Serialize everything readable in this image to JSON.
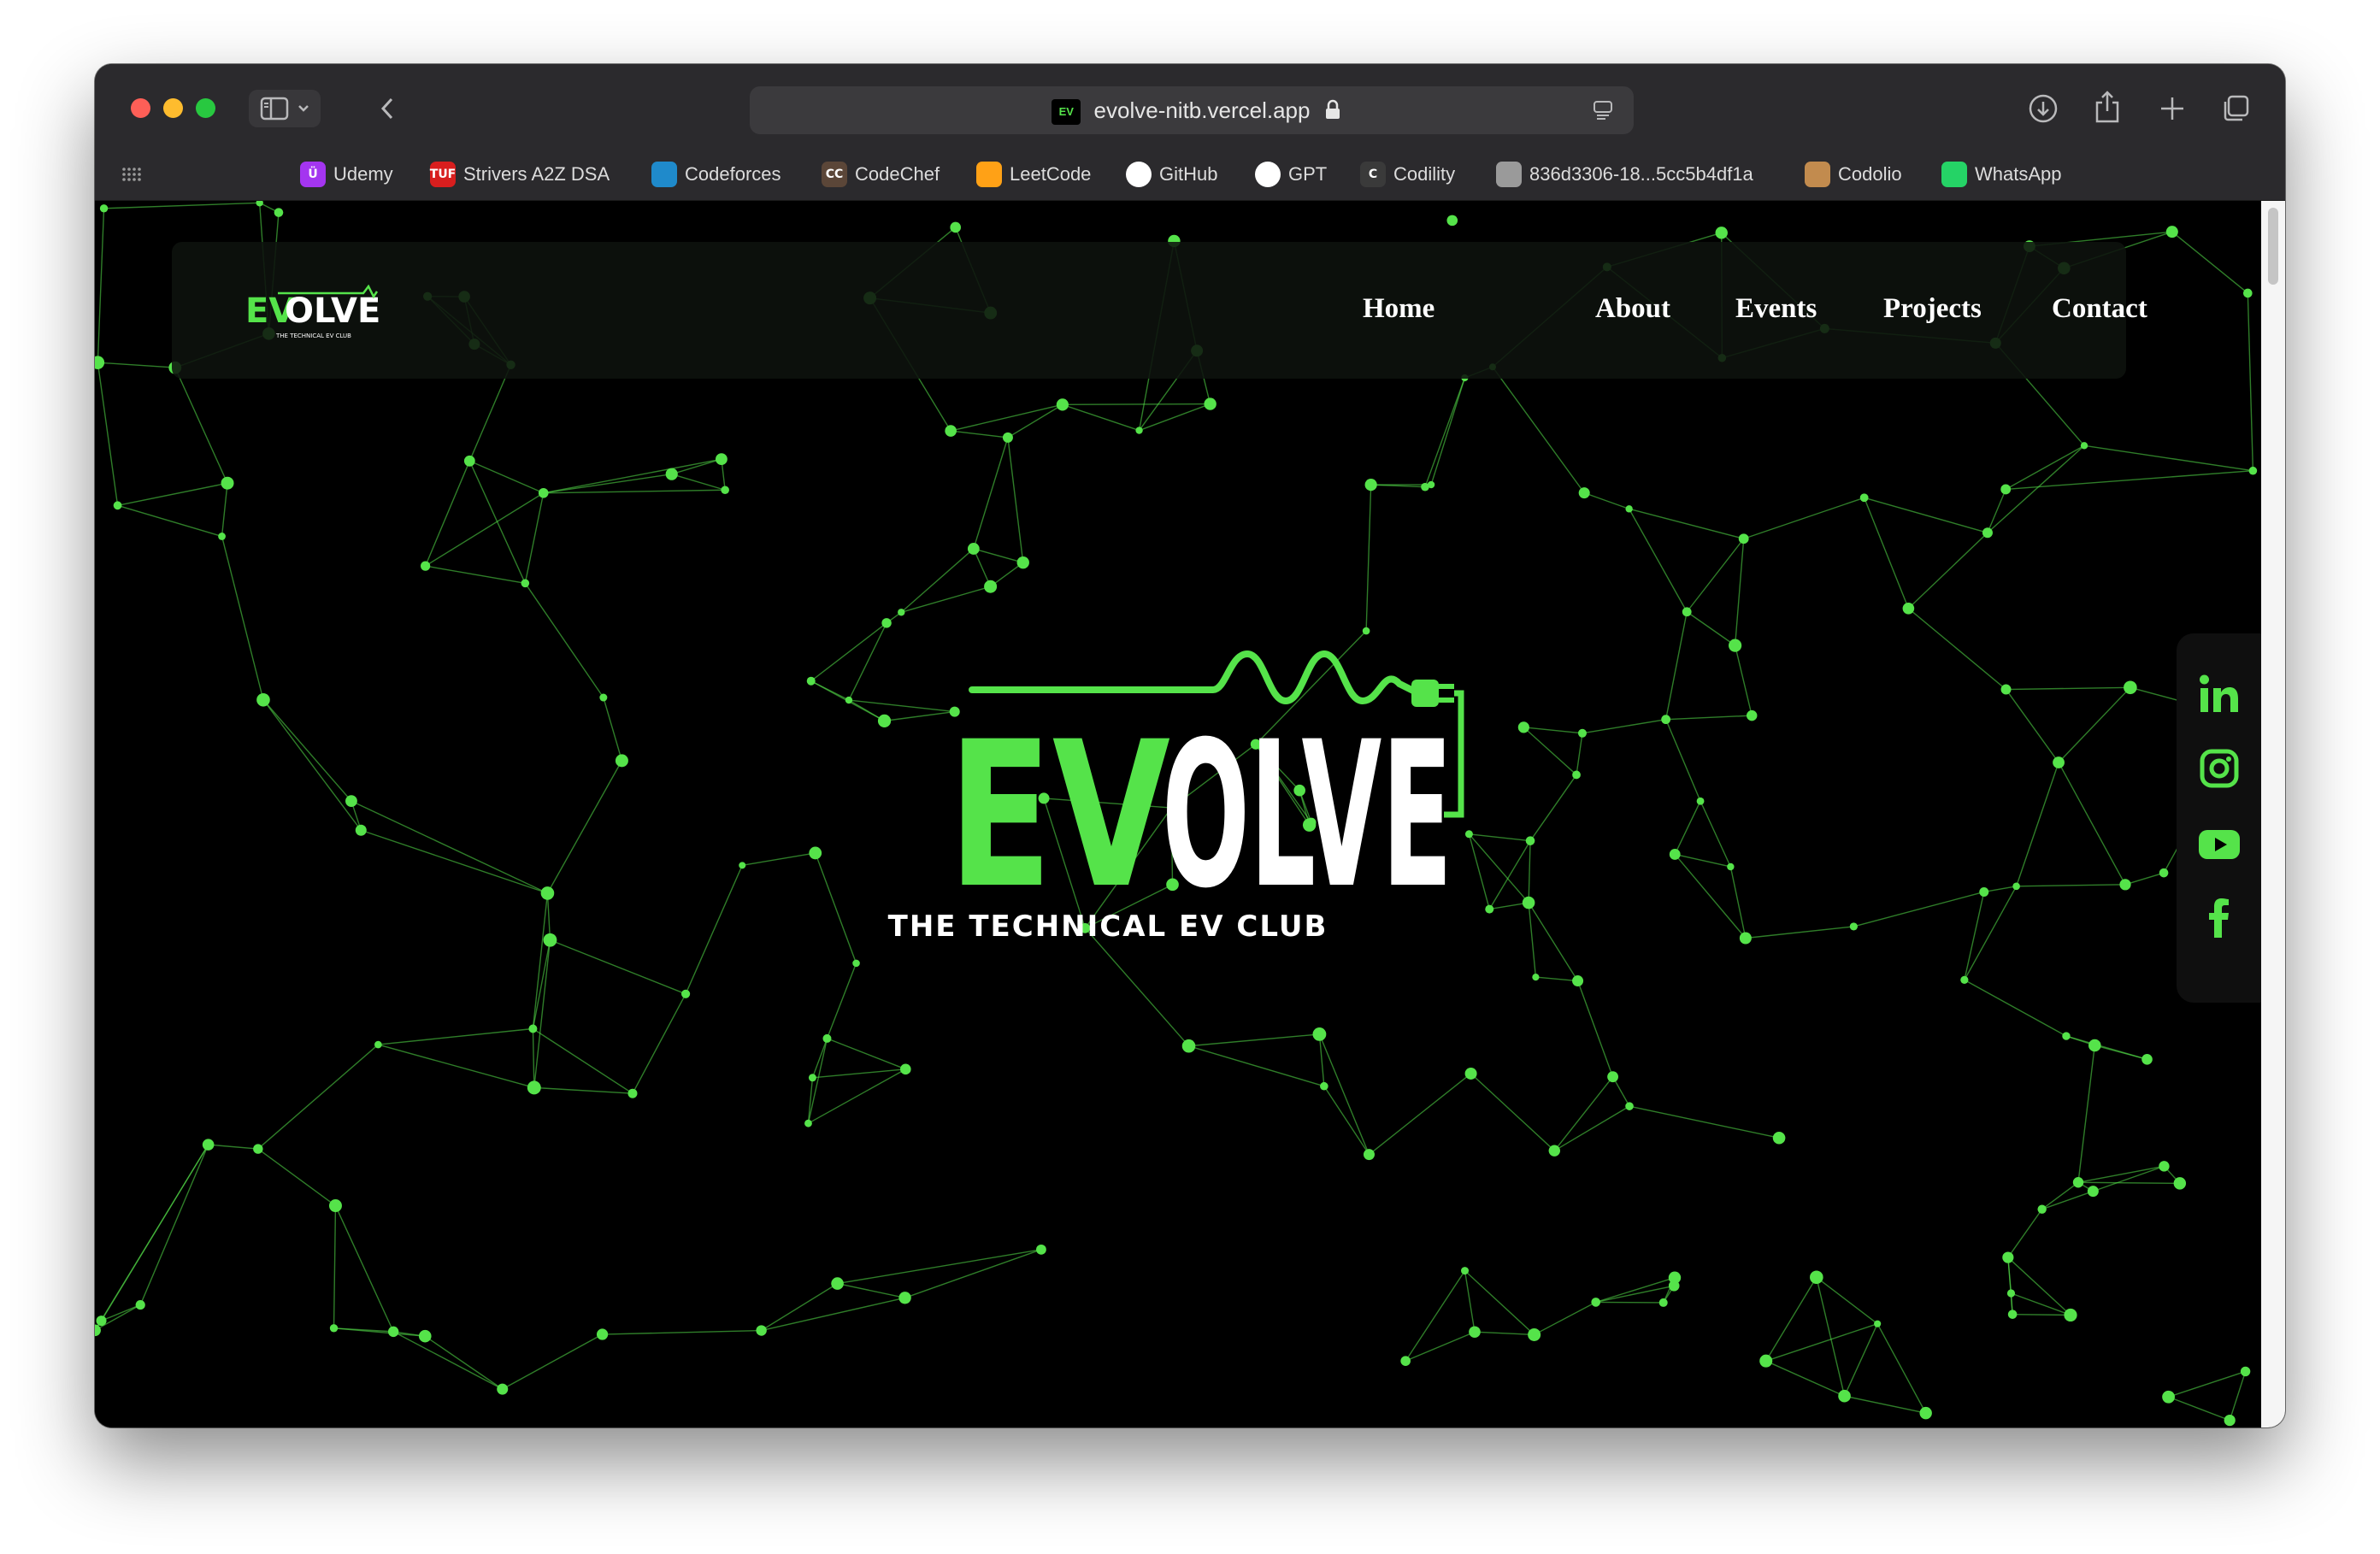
{
  "browser": {
    "url": "evolve-nitb.vercel.app",
    "bookmarks": [
      {
        "label": "Udemy",
        "icon": "udemy-icon",
        "badge": "Ü",
        "color": "#a435f0"
      },
      {
        "label": "Strivers A2Z DSA",
        "icon": "tuf-icon",
        "badge": "TUF",
        "color": "#d81e1e"
      },
      {
        "label": "Codeforces",
        "icon": "codeforces-icon",
        "badge": "",
        "color": "#1f8acb"
      },
      {
        "label": "CodeChef",
        "icon": "codechef-icon",
        "badge": "CC",
        "color": "#5b4638"
      },
      {
        "label": "LeetCode",
        "icon": "leetcode-icon",
        "badge": "",
        "color": "#ffa116"
      },
      {
        "label": "GitHub",
        "icon": "github-icon",
        "badge": "",
        "color": "#ffffff"
      },
      {
        "label": "GPT",
        "icon": "gpt-icon",
        "badge": "",
        "color": "#ffffff"
      },
      {
        "label": "Codility",
        "icon": "codility-icon",
        "badge": "C",
        "color": "#3a3a3a"
      },
      {
        "label": "836d3306-18...5cc5b4df1a",
        "icon": "globe-icon",
        "badge": "",
        "color": "#9a9a9a"
      },
      {
        "label": "Codolio",
        "icon": "codolio-icon",
        "badge": "",
        "color": "#c28b4e"
      },
      {
        "label": "WhatsApp",
        "icon": "whatsapp-icon",
        "badge": "",
        "color": "#25d366"
      }
    ]
  },
  "site": {
    "logo_text_green": "EV",
    "logo_text_white": "OLVE",
    "tagline": "THE TECHNICAL EV CLUB",
    "nav": [
      "Home",
      "About",
      "Events",
      "Projects",
      "Contact"
    ],
    "socials": [
      "linkedin-icon",
      "instagram-icon",
      "youtube-icon",
      "facebook-icon"
    ],
    "accent": "#55e34a"
  }
}
